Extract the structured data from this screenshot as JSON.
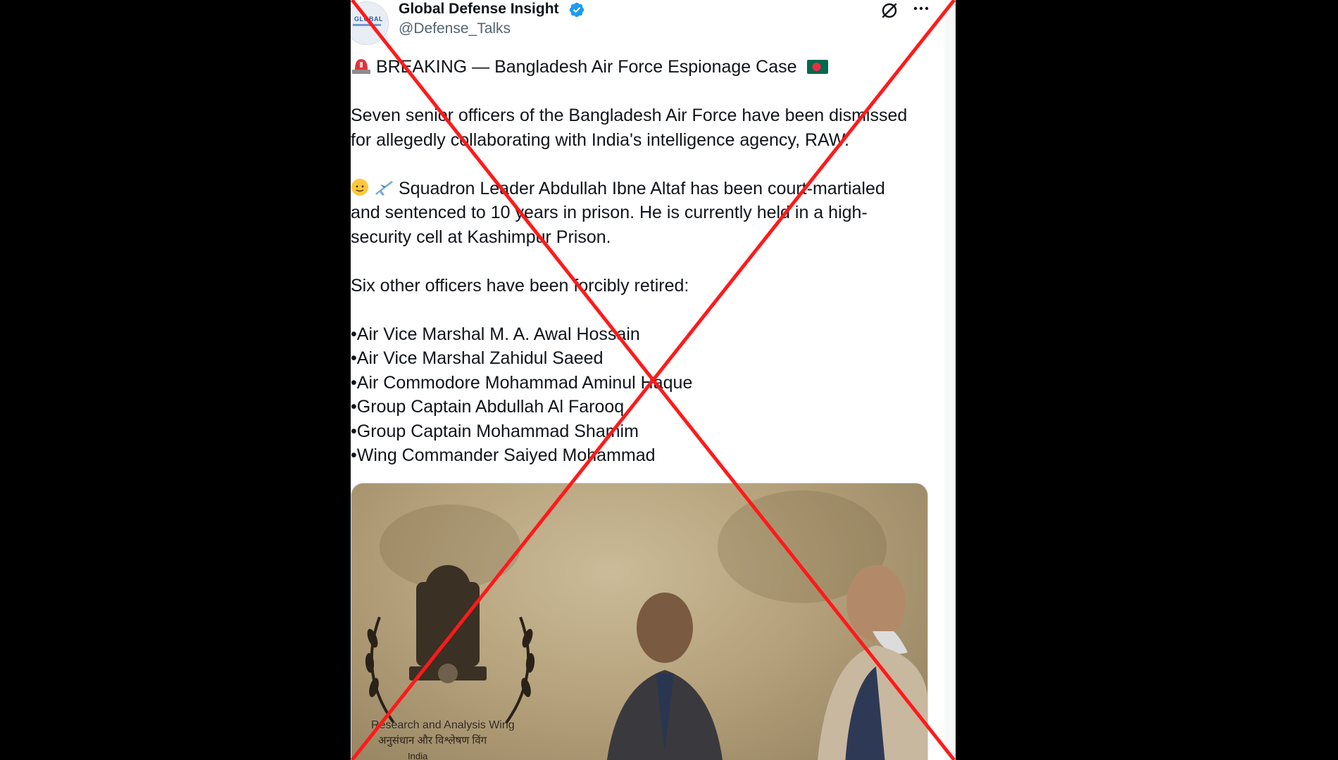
{
  "account": {
    "display_name": "Global Defense Insight",
    "handle": "@Defense_Talks",
    "avatar_text": "GLOBAL",
    "verified": true
  },
  "icons": {
    "verified": "verified-badge-icon",
    "grok": "grok-icon",
    "more": "more-options-icon",
    "siren": "police-light-emoji",
    "flag": "bangladesh-flag-emoji",
    "person": "person-emoji",
    "plane": "airplane-emoji"
  },
  "tweet": {
    "headline": "BREAKING — Bangladesh Air Force Espionage Case",
    "para1_line1": "Seven senior officers of the Bangladesh Air Force have been dismissed",
    "para1_line2": "for allegedly collaborating with India's intelligence agency, RAW.",
    "para2_line1": "Squadron Leader Abdullah Ibne Altaf has been court-martialed",
    "para2_line2": "and sentenced to 10 years in prison. He is currently held in a high-",
    "para2_line3": "security cell at Kashimpur Prison.",
    "para3": "Six other officers have been forcibly retired:",
    "officers": [
      "Air Vice Marshal M. A. Awal Hossain",
      "Air Vice Marshal Zahidul Saeed",
      "Air Commodore Mohammad Aminul Haque",
      "Group Captain Abdullah Al Farooq",
      "Group Captain Mohammad Shamim",
      "Wing Commander Saiyed Mohammad"
    ]
  },
  "media": {
    "caption_line1": "Research and Analysis Wing",
    "caption_line2": "अनुसंधान और विश्लेषण विंग",
    "caption_line3": "India"
  },
  "colors": {
    "background": "#000000",
    "panel": "#ffffff",
    "text": "#0f1419",
    "secondary_text": "#536471",
    "verified_blue": "#1d9bf0",
    "cross_red": "#ff1a1a",
    "siren_red": "#e0343a",
    "flag_green": "#006a4e",
    "flag_red": "#f42a41"
  }
}
